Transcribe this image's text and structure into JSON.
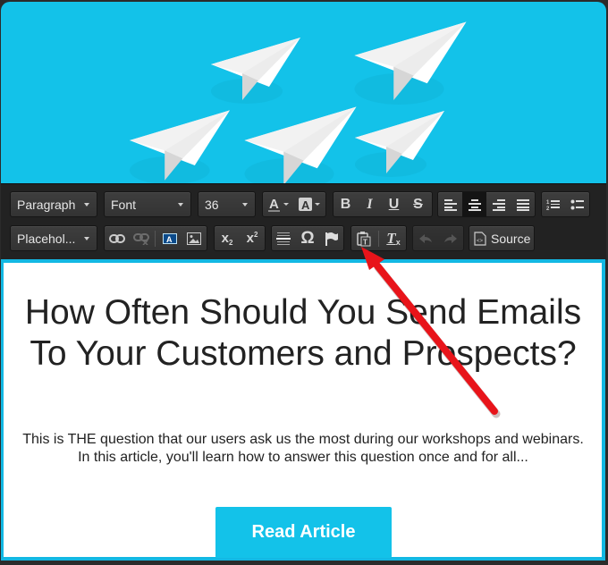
{
  "toolbar": {
    "row1": {
      "format_select": "Paragraph",
      "font_select": "Font",
      "size_select": "36",
      "text_color_icon": "text-color-icon",
      "bg_color_icon": "background-color-icon",
      "bold": "B",
      "italic": "I",
      "underline": "U",
      "strike": "S",
      "align": [
        "align-left-icon",
        "align-center-icon",
        "align-right-icon",
        "align-justify-icon"
      ],
      "active_align": "center",
      "lists": [
        "numbered-list-icon",
        "bulleted-list-icon"
      ]
    },
    "row2": {
      "placeholder_select": "Placehol...",
      "link_icons": [
        "link-icon",
        "unlink-icon"
      ],
      "media_icons": [
        "text-field-icon",
        "image-icon"
      ],
      "subscript": "x",
      "subscript_sub": "2",
      "superscript": "x",
      "superscript_sup": "2",
      "misc_icons": [
        "horizontal-rule-icon",
        "special-char-icon",
        "anchor-flag-icon"
      ],
      "special_char": "Ω",
      "paste_text_icon": "paste-as-text-icon",
      "remove_format_icon": "remove-format-icon",
      "remove_format_letter": "T",
      "undo_icon": "undo-icon",
      "redo_icon": "redo-icon",
      "source_label": "Source"
    }
  },
  "article": {
    "headline": "How Often Should You Send Emails To Your Customers and Prospects?",
    "excerpt": "This is THE question that our users ask us the most during our workshops and webinars. In this article, you'll learn how to answer this question once and for all...",
    "cta_label": "Read Article"
  },
  "annotation": {
    "type": "red-arrow",
    "points_to": "paste-as-text-button",
    "color": "#e8141a"
  },
  "colors": {
    "brand_cyan": "#13c2e9",
    "toolbar_bg": "#222222",
    "text": "#222222"
  }
}
